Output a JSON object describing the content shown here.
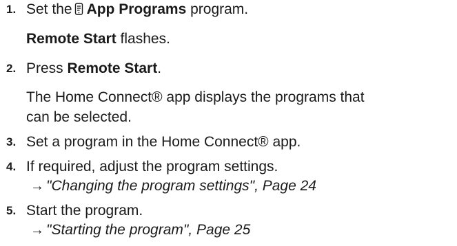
{
  "steps": [
    {
      "number": "1.",
      "text_pre": "Set the",
      "icon": "app-programs-icon",
      "bold": "App Programs",
      "text_post": " program.",
      "result_bold": "Remote Start",
      "result_text": " flashes."
    },
    {
      "number": "2.",
      "text_pre": "Press ",
      "bold": "Remote Start",
      "text_post": ".",
      "result_line1": "The Home Connect® app displays the programs that",
      "result_line2": "can be selected."
    },
    {
      "number": "3.",
      "text": "Set a program in the Home Connect® app."
    },
    {
      "number": "4.",
      "text": "If required, adjust the program settings.",
      "reference_arrow": "→",
      "reference": "\"Changing the program settings\", Page 24"
    },
    {
      "number": "5.",
      "text": "Start the program.",
      "reference_arrow": "→",
      "reference": "\"Starting the program\", Page 25"
    }
  ]
}
